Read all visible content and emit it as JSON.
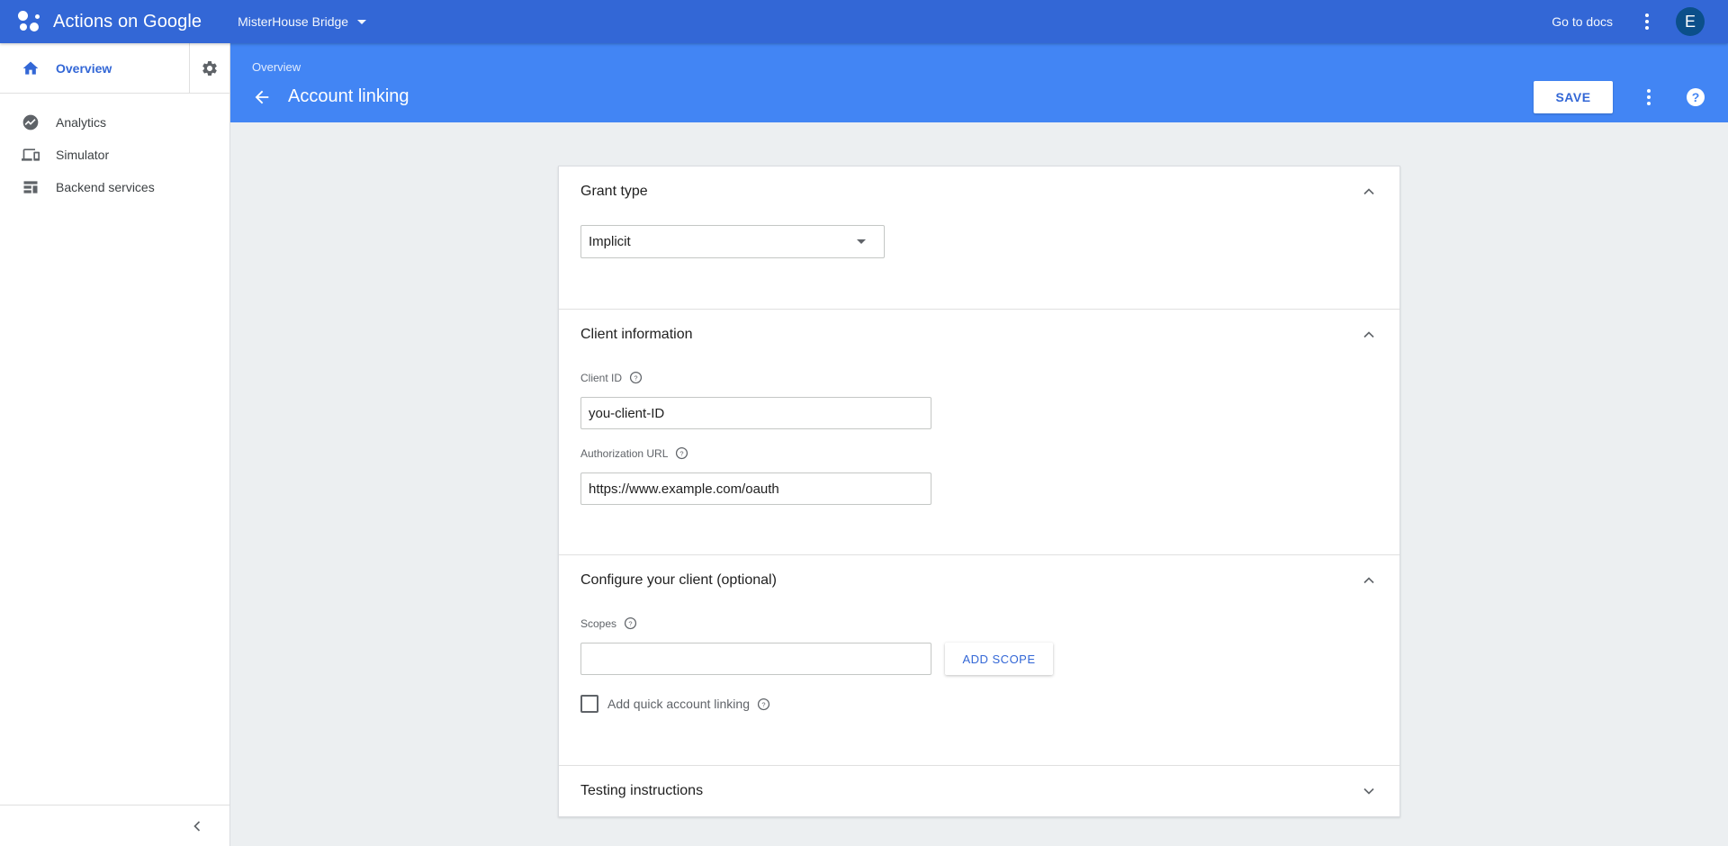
{
  "topbar": {
    "app_name": "Actions on Google",
    "project": "MisterHouse Bridge",
    "docs_link": "Go to docs",
    "avatar_letter": "E"
  },
  "sidebar": {
    "overview": "Overview",
    "items": [
      {
        "label": "Analytics",
        "icon": "analytics-icon"
      },
      {
        "label": "Simulator",
        "icon": "simulator-icon"
      },
      {
        "label": "Backend services",
        "icon": "backend-services-icon"
      }
    ]
  },
  "header": {
    "breadcrumb": "Overview",
    "title": "Account linking",
    "save_label": "SAVE"
  },
  "sections": {
    "grant_type": {
      "title": "Grant type",
      "selected": "Implicit",
      "expanded": true
    },
    "client_info": {
      "title": "Client information",
      "client_id_label": "Client ID",
      "client_id_value": "you-client-ID",
      "auth_url_label": "Authorization URL",
      "auth_url_value": "https://www.example.com/oauth",
      "expanded": true
    },
    "configure": {
      "title": "Configure your client (optional)",
      "scopes_label": "Scopes",
      "scopes_value": "",
      "add_scope_label": "ADD SCOPE",
      "quick_linking_label": "Add quick account linking",
      "quick_linking_checked": false,
      "expanded": true
    },
    "testing": {
      "title": "Testing instructions",
      "expanded": false
    }
  },
  "colors": {
    "topbar": "#3367d6",
    "header_band": "#4285f4",
    "accent": "#3367d6",
    "background": "#eceff1"
  }
}
